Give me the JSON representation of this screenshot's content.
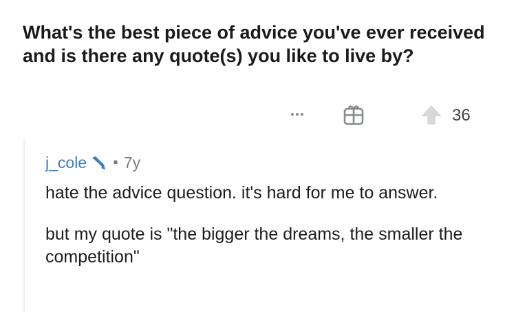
{
  "post": {
    "title": "What's the best piece of advice you've ever received and is there any quote(s) you like to live by?",
    "vote_count": "36",
    "icons": {
      "more": "more-horizontal-icon",
      "award": "gift-award-icon",
      "upvote": "upvote-arrow-icon"
    }
  },
  "comment": {
    "username": "j_cole",
    "separator": "•",
    "timestamp": "7y",
    "paragraphs": [
      "hate the advice question. it's hard for me to answer.",
      "but my quote is \"the bigger the dreams, the smaller the competition\""
    ]
  },
  "colors": {
    "username": "#3e7fc1",
    "muted": "#878a8c",
    "text": "#1c1c1c",
    "thread_line": "#edeff1"
  }
}
